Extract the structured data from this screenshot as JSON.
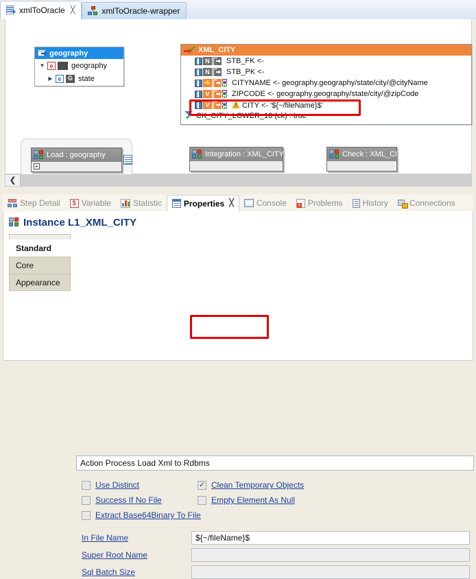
{
  "editor_tabs": [
    {
      "label": "xmlToOracle",
      "icon": "xml-file-icon",
      "active": true,
      "closable": true
    },
    {
      "label": "xmlToOracle-wrapper",
      "icon": "wrapper-icon",
      "active": false,
      "closable": false
    }
  ],
  "canvas": {
    "source_tree": {
      "header": "geography",
      "header_icon": "table-arrow-icon",
      "nodes": [
        {
          "label": "geography",
          "twisty": "▼",
          "badge": "e",
          "extra": "dark-block"
        },
        {
          "label": "state",
          "twisty": "▶",
          "badge": "e",
          "extra": "G"
        }
      ]
    },
    "target_panel": {
      "title": "XML_CITY",
      "title_icon": "red-arrow-check-icon",
      "mappings": [
        {
          "flag": "N",
          "flag_type": "n",
          "out_color": "gray",
          "markers": false,
          "warn": false,
          "text": "STB_FK <-"
        },
        {
          "flag": "N",
          "flag_type": "n",
          "out_color": "gray",
          "markers": false,
          "warn": false,
          "text": "STB_PK <-"
        },
        {
          "flag": "",
          "flag_type": "key",
          "out_color": "orange",
          "markers": true,
          "warn": false,
          "text": "CITYNAME <- geography.geography/state/city/@cityName"
        },
        {
          "flag": "V",
          "flag_type": "v",
          "out_color": "orange",
          "markers": true,
          "warn": false,
          "text": "ZIPCODE <- geography.geography/state/city/@zipCode"
        },
        {
          "flag": "V",
          "flag_type": "v",
          "out_color": "orange",
          "markers": true,
          "warn": true,
          "text": "CITY <- '${~/fileName}$'"
        }
      ],
      "constraint": {
        "icon": "filter-check-icon",
        "text": "CK_CITY_LOWER_10 (ck) : true"
      }
    },
    "process_boxes": [
      {
        "name": "load-geography-box",
        "label": "Load : geography",
        "has_plus": true,
        "in_container": true
      },
      {
        "name": "integration-box",
        "label": "Integration : XML_CITY",
        "has_plus": false,
        "in_container": false
      },
      {
        "name": "check-box",
        "label": "Check : XML_CITY",
        "has_plus": false,
        "in_container": false
      }
    ],
    "scrollbar": {
      "left_arrow": "❮"
    }
  },
  "annotations": {
    "highlight_color": "#e30000",
    "boxes": [
      {
        "name": "city-mapping-highlight",
        "target": "CITY <- '${~/fileName}$'"
      },
      {
        "name": "in-file-name-highlight",
        "target": "${~/fileName}$"
      }
    ]
  },
  "view_tabs": [
    {
      "label": "Step Detail",
      "icon": "step-detail-icon",
      "active": false,
      "closable": false
    },
    {
      "label": "Variable",
      "icon": "dollar-icon",
      "active": false,
      "closable": false
    },
    {
      "label": "Statistic",
      "icon": "statistic-icon",
      "active": false,
      "closable": false
    },
    {
      "label": "Properties",
      "icon": "properties-icon",
      "active": true,
      "closable": true
    },
    {
      "label": "Console",
      "icon": "console-icon",
      "active": false,
      "closable": false
    },
    {
      "label": "Problems",
      "icon": "problems-icon",
      "active": false,
      "closable": false
    },
    {
      "label": "History",
      "icon": "history-icon",
      "active": false,
      "closable": false
    },
    {
      "label": "Connections",
      "icon": "connections-icon",
      "active": false,
      "closable": false
    }
  ],
  "properties": {
    "title": "Instance L1_XML_CITY",
    "title_icon": "process-icon",
    "left_tabs": [
      {
        "label": "Standard",
        "active": true
      },
      {
        "label": "Core",
        "active": false
      },
      {
        "label": "Appearance",
        "active": false
      }
    ],
    "action_field": {
      "value": "Action Process Load Xml to Rdbms"
    },
    "checkboxes": [
      {
        "label": "Use Distinct",
        "checked": false
      },
      {
        "label": "Clean Temporary Objects",
        "checked": true
      },
      {
        "label": "Success If No File",
        "checked": false
      },
      {
        "label": "Empty Element As Null",
        "checked": false
      },
      {
        "label": "Extract Base64Binary To File",
        "checked": false
      }
    ],
    "fields": [
      {
        "label": "In File Name",
        "value": "${~/fileName}$",
        "readonly": false
      },
      {
        "label": "Super Root Name",
        "value": "",
        "readonly": true
      },
      {
        "label": "Sql Batch Size",
        "value": "",
        "readonly": true
      }
    ]
  }
}
